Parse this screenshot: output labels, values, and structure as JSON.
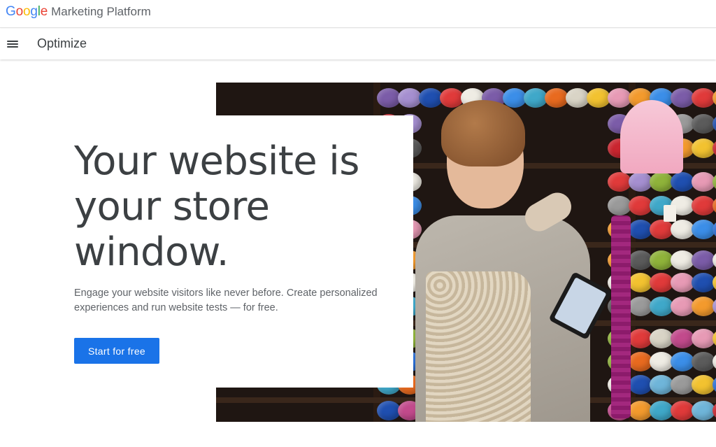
{
  "brandbar": {
    "logo_letters": [
      {
        "char": "G",
        "color": "#4285F4"
      },
      {
        "char": "o",
        "color": "#EA4335"
      },
      {
        "char": "o",
        "color": "#FBBC05"
      },
      {
        "char": "g",
        "color": "#4285F4"
      },
      {
        "char": "l",
        "color": "#34A853"
      },
      {
        "char": "e",
        "color": "#EA4335"
      }
    ],
    "product_label": "Marketing Platform"
  },
  "productbar": {
    "menu_icon": "hamburger-menu-icon",
    "product_name": "Optimize"
  },
  "hero": {
    "title": "Your website is your store window.",
    "subtitle": "Engage your website visitors like never before. Create personalized experiences and run website tests — for free.",
    "cta_label": "Start for free",
    "cta_color": "#1a73e8"
  }
}
